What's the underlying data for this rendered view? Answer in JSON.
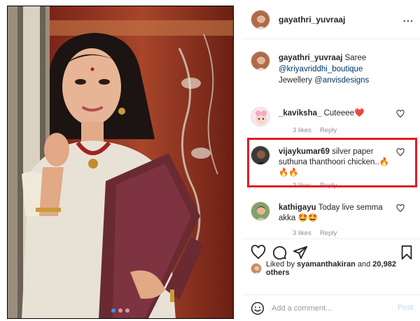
{
  "post": {
    "username": "gayathri_yuvraaj",
    "caption": {
      "author": "gayathri_yuvraaj",
      "text": "Saree",
      "mention_1": "@kriyavriddhi_boutique",
      "line2_text": "Jewellery",
      "mention_2": "@anvisdesigns"
    },
    "comments": [
      {
        "author": "_kaviksha_",
        "text": "Cuteeee❤️",
        "likes": "3 likes",
        "reply": "Reply"
      },
      {
        "author": "vijaykumar69",
        "text": "silver paper suthuna thanthoori chicken..🔥🔥🔥",
        "likes": "3 likes",
        "reply": "Reply"
      },
      {
        "author": "kathigayu",
        "text": "Today live semma akka 🤩🤩",
        "likes": "3 likes",
        "reply": "Reply"
      }
    ],
    "liked_by_prefix": "Liked by",
    "liked_by_user": "syamanthakiran",
    "liked_by_and": "and",
    "liked_by_others": "20,982 others",
    "add_comment_placeholder": "Add a comment...",
    "post_label": "Post",
    "photo_dots": 3,
    "active_dot": 1,
    "colors": {
      "highlight": "#e31b23",
      "link": "#00376b",
      "post_disabled": "#b2dffc",
      "meta": "#8e8e8e"
    },
    "icons": [
      "more-icon",
      "heart-icon",
      "comment-icon",
      "share-icon",
      "bookmark-icon",
      "smiley-icon"
    ]
  }
}
